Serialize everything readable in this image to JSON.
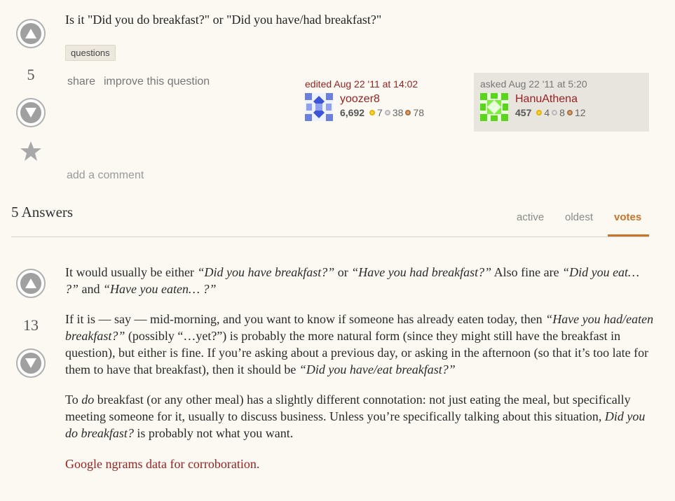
{
  "question": {
    "title": "Is it \"Did you do breakfast?\" or \"Did you have/had breakfast?\"",
    "votes": "5",
    "tag": "questions",
    "menu": {
      "share": "share",
      "improve": "improve this question"
    },
    "edited": {
      "label": "edited Aug 22 '11 at 14:02",
      "user": "yoozer8",
      "rep": "6,692",
      "gold": "7",
      "silver": "38",
      "bronze": "78"
    },
    "asked": {
      "label": "asked Aug 22 '11 at 5:20",
      "user": "HanuAthena",
      "rep": "457",
      "gold": "4",
      "silver": "8",
      "bronze": "12"
    },
    "add_comment": "add a comment"
  },
  "answers_header": {
    "count_label": "5 Answers",
    "tabs": [
      "active",
      "oldest",
      "votes"
    ],
    "active_tab": "votes"
  },
  "answer": {
    "votes": "13",
    "p1": {
      "t1": "It would usually be either ",
      "i1": "“Did you have breakfast?”",
      "t2": " or ",
      "i2": "“Have you had breakfast?”",
      "t3": " Also fine are ",
      "i3": "“Did you eat… ?”",
      "t4": " and ",
      "i4": "“Have you eaten… ?”"
    },
    "p2": {
      "t1": "If it is — say — mid-morning, and you want to know if someone has already eaten today, then ",
      "i1": "“Have you had/eaten breakfast?”",
      "t2": " (possibly “…yet?”) is probably the more natural form (since they might still have the breakfast in question), but either is fine. If you’re asking about a previous day, or asking in the afternoon (so that it’s too late for them to have that breakfast), then it should be ",
      "i2": "“Did you have/eat breakfast?”"
    },
    "p3": {
      "t1": "To ",
      "i1": "do",
      "t2": " breakfast (or any other meal) has a slightly different connotation: not just eating the meal, but specifically meeting someone for it, usually to discuss business. Unless you’re specifically talking about this situation, ",
      "i2": "Did you do breakfast?",
      "t3": " is probably not what you want."
    },
    "link": "Google ngrams data for corroboration."
  },
  "colors": {
    "link": "#9a1f1f",
    "active_tab": "#c8742a",
    "asked_bg": "#e8e5de"
  }
}
